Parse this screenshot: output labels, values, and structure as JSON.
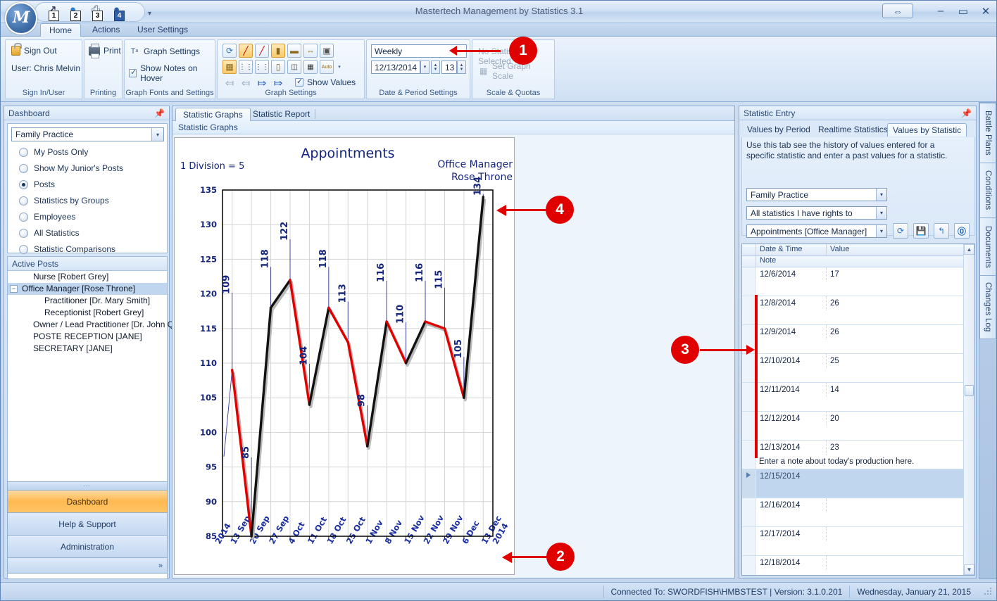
{
  "window": {
    "title": "Mastertech Management by Statistics 3.1",
    "logo_letter": "M",
    "minimize": "–",
    "maximize": "▭",
    "close": "✕",
    "restore_icon": "⇔"
  },
  "quick_access": [
    {
      "name": "export-icon",
      "glyph": "↗",
      "num": "1",
      "style": "white"
    },
    {
      "name": "globe-icon",
      "glyph": "🌍",
      "num": "2",
      "style": "white"
    },
    {
      "name": "print-icon",
      "glyph": "⎙",
      "num": "3",
      "style": "white"
    },
    {
      "name": "help-icon",
      "glyph": "?",
      "num": "4",
      "style": "blue"
    }
  ],
  "ribbon": {
    "tabs": [
      {
        "label": "Home",
        "active": true
      },
      {
        "label": "Actions",
        "active": false
      },
      {
        "label": "User Settings",
        "active": false
      }
    ],
    "groups": [
      {
        "name": "sign-in-user",
        "label": "Sign In/User",
        "items": [
          {
            "label": "Sign Out",
            "icon": "lock-icon"
          },
          {
            "label": "User: Chris Melvin",
            "icon": "none"
          }
        ]
      },
      {
        "name": "printing",
        "label": "Printing",
        "items": [
          {
            "label": "Print",
            "icon": "printer-icon"
          }
        ]
      },
      {
        "name": "graph-fonts-settings",
        "label": "Graph Fonts and Settings",
        "items": [
          {
            "label": "Graph Settings",
            "icon": "font-icon"
          },
          {
            "label": "Show Notes on Hover",
            "icon": "checkbox",
            "checked": true
          }
        ]
      },
      {
        "name": "graph-settings",
        "label": "Graph Settings",
        "items": [
          {
            "label": "Show Values",
            "icon": "checkbox",
            "checked": true
          }
        ],
        "icon_row_1": [
          {
            "name": "refresh-icon",
            "glyph": "⟳",
            "active": false
          },
          {
            "name": "line-up-icon",
            "glyph": "↗",
            "active": true
          },
          {
            "name": "line-down-icon",
            "glyph": "↘",
            "active": false
          },
          {
            "name": "page-icon",
            "glyph": "▭",
            "active": true
          },
          {
            "name": "landscape-icon",
            "glyph": "▭",
            "active": false
          },
          {
            "name": "page-width-icon",
            "glyph": "⬌",
            "active": false
          },
          {
            "name": "frame-icon",
            "glyph": "▢",
            "active": false
          }
        ],
        "icon_row_2": [
          {
            "name": "left-scale-icon",
            "glyph": "◧",
            "active": true
          },
          {
            "name": "scale-left-labels-icon",
            "glyph": "⫤",
            "active": false
          },
          {
            "name": "scale-right-labels-icon",
            "glyph": "⫣",
            "active": false
          },
          {
            "name": "fit-icon",
            "glyph": "▭",
            "active": false
          },
          {
            "name": "two-col-icon",
            "glyph": "◫",
            "active": false
          },
          {
            "name": "three-col-icon",
            "glyph": "▦",
            "active": false
          },
          {
            "name": "auto-scale-icon",
            "glyph": "Auto",
            "active": false
          }
        ],
        "icon_row_3": [
          {
            "name": "first-period-icon",
            "glyph": "⇤",
            "active": false
          },
          {
            "name": "previous-period-icon",
            "glyph": "←",
            "active": false
          },
          {
            "name": "next-period-icon",
            "glyph": "→",
            "active": false
          },
          {
            "name": "last-period-icon",
            "glyph": "⇥",
            "active": false
          }
        ]
      },
      {
        "name": "date-period-settings",
        "label": "Date & Period Settings",
        "period_value": "Weekly",
        "date_value": "12/13/2014",
        "count_value": "13"
      },
      {
        "name": "scale-quotas",
        "label": "Scale & Quotas",
        "status_text": "No Statistic Selected",
        "set_scale_label": "Set Graph Scale"
      }
    ]
  },
  "sidebar": {
    "header": "Dashboard",
    "practice_select": "Family Practice",
    "radios": [
      {
        "label": "My Posts Only",
        "selected": false
      },
      {
        "label": "Show My Junior's Posts",
        "selected": false
      },
      {
        "label": "Posts",
        "selected": true
      },
      {
        "label": "Statistics by Groups",
        "selected": false
      },
      {
        "label": "Employees",
        "selected": false
      },
      {
        "label": "All Statistics",
        "selected": false
      },
      {
        "label": "Statistic Comparisons",
        "selected": false
      }
    ],
    "posts_header": "Active Posts",
    "posts": [
      {
        "label": "Nurse [Robert Grey]",
        "indent": 1,
        "expander": false,
        "selected": false
      },
      {
        "label": "Office Manager [Rose Throne]",
        "indent": 0,
        "expander": true,
        "selected": true
      },
      {
        "label": "Practitioner  [Dr. Mary Smith]",
        "indent": 2,
        "expander": false,
        "selected": false
      },
      {
        "label": "Receptionist  [Robert Grey]",
        "indent": 2,
        "expander": false,
        "selected": false
      },
      {
        "label": "Owner / Lead Practitioner  [Dr. John Que]",
        "indent": 1,
        "expander": false,
        "selected": false
      },
      {
        "label": "POSTE RECEPTION [JANE]",
        "indent": 1,
        "expander": false,
        "selected": false
      },
      {
        "label": "SECRETARY [JANE]",
        "indent": 1,
        "expander": false,
        "selected": false
      }
    ],
    "nav_buttons": [
      {
        "label": "Dashboard",
        "active": true
      },
      {
        "label": "Help & Support",
        "active": false
      },
      {
        "label": "Administration",
        "active": false
      }
    ],
    "nav_overflow": "»"
  },
  "center": {
    "tabs": [
      {
        "label": "Statistic Graphs",
        "active": true
      },
      {
        "label": "Statistic Report",
        "active": false
      }
    ],
    "sub_header": "Statistic Graphs"
  },
  "chart_data": {
    "type": "line",
    "title": "Appointments",
    "subtitle_left": "1 Division = 5",
    "subtitle_right_line1": "Office Manager",
    "subtitle_right_line2": "Rose Throne",
    "xlabel": "",
    "ylabel": "",
    "ylim": [
      85,
      135
    ],
    "y_ticks": [
      85,
      90,
      95,
      100,
      105,
      110,
      115,
      120,
      125,
      130,
      135
    ],
    "grid": true,
    "legend": "none",
    "x_axis_left_year": "2014",
    "x_axis_right_year": "2014",
    "categories": [
      "13 Sep",
      "20 Sep",
      "27 Sep",
      "4 Oct",
      "11 Oct",
      "18 Oct",
      "25 Oct",
      "1 Nov",
      "8 Nov",
      "15 Nov",
      "22 Nov",
      "29 Nov",
      "6 Dec",
      "13 Dec"
    ],
    "values": [
      109,
      85,
      118,
      122,
      104,
      118,
      113,
      98,
      116,
      110,
      116,
      115,
      105,
      134
    ],
    "point_labels": [
      "109",
      "85",
      "118",
      "122",
      "104",
      "118",
      "113",
      "98",
      "116",
      "110",
      "116",
      "115",
      "105",
      "134"
    ],
    "segment_colors": [
      "#e00000",
      "#111111",
      "#111111",
      "#e00000",
      "#111111",
      "#e00000",
      "#e00000",
      "#111111",
      "#e00000",
      "#111111",
      "#e00000",
      "#e00000",
      "#111111"
    ],
    "color_up": "#111111",
    "color_down": "#e00000",
    "label_color": "#15257c"
  },
  "statistic_entry": {
    "header": "Statistic Entry",
    "tabs": [
      {
        "label": "Values by Period",
        "active": false
      },
      {
        "label": "Realtime Statistics",
        "active": false
      },
      {
        "label": "Values by Statistic",
        "active": true
      }
    ],
    "description": "Use this tab see the history of values entered for a specific statistic and enter a past values for a statistic.",
    "select_practice": "Family Practice",
    "select_rights": "All statistics I have rights to",
    "select_statistic": "Appointments [Office Manager]",
    "tool_buttons": [
      {
        "name": "refresh-icon",
        "glyph": "⟳"
      },
      {
        "name": "save-icon",
        "glyph": "💾"
      },
      {
        "name": "import-icon",
        "glyph": "↰"
      },
      {
        "name": "help-icon",
        "glyph": "?"
      }
    ],
    "grid_headers": {
      "date": "Date & Time",
      "value": "Value",
      "note": "Note"
    },
    "rows": [
      {
        "date": "12/6/2014",
        "value": "17",
        "note": "",
        "current": false
      },
      {
        "date": "12/8/2014",
        "value": "26",
        "note": "",
        "current": false
      },
      {
        "date": "12/9/2014",
        "value": "26",
        "note": "",
        "current": false
      },
      {
        "date": "12/10/2014",
        "value": "25",
        "note": "",
        "current": false
      },
      {
        "date": "12/11/2014",
        "value": "14",
        "note": "",
        "current": false
      },
      {
        "date": "12/12/2014",
        "value": "20",
        "note": "",
        "current": false
      },
      {
        "date": "12/13/2014",
        "value": "23",
        "note": "Enter a note about today's production here.",
        "current": false
      },
      {
        "date": "12/15/2014",
        "value": "",
        "note": "",
        "current": true
      },
      {
        "date": "12/16/2014",
        "value": "",
        "note": "",
        "current": false
      },
      {
        "date": "12/17/2014",
        "value": "",
        "note": "",
        "current": false
      },
      {
        "date": "12/18/2014",
        "value": "",
        "note": "",
        "current": false
      }
    ]
  },
  "vertical_tabs": [
    {
      "label": "Battle Plans"
    },
    {
      "label": "Conditions"
    },
    {
      "label": "Documents"
    },
    {
      "label": "Changes Log"
    }
  ],
  "statusbar": {
    "connection": "Connected To: SWORDFISH\\HMBSTEST | Version: 3.1.0.201",
    "date": "Wednesday, January 21, 2015"
  },
  "callouts": [
    {
      "number": "1"
    },
    {
      "number": "2"
    },
    {
      "number": "3"
    },
    {
      "number": "4"
    }
  ]
}
